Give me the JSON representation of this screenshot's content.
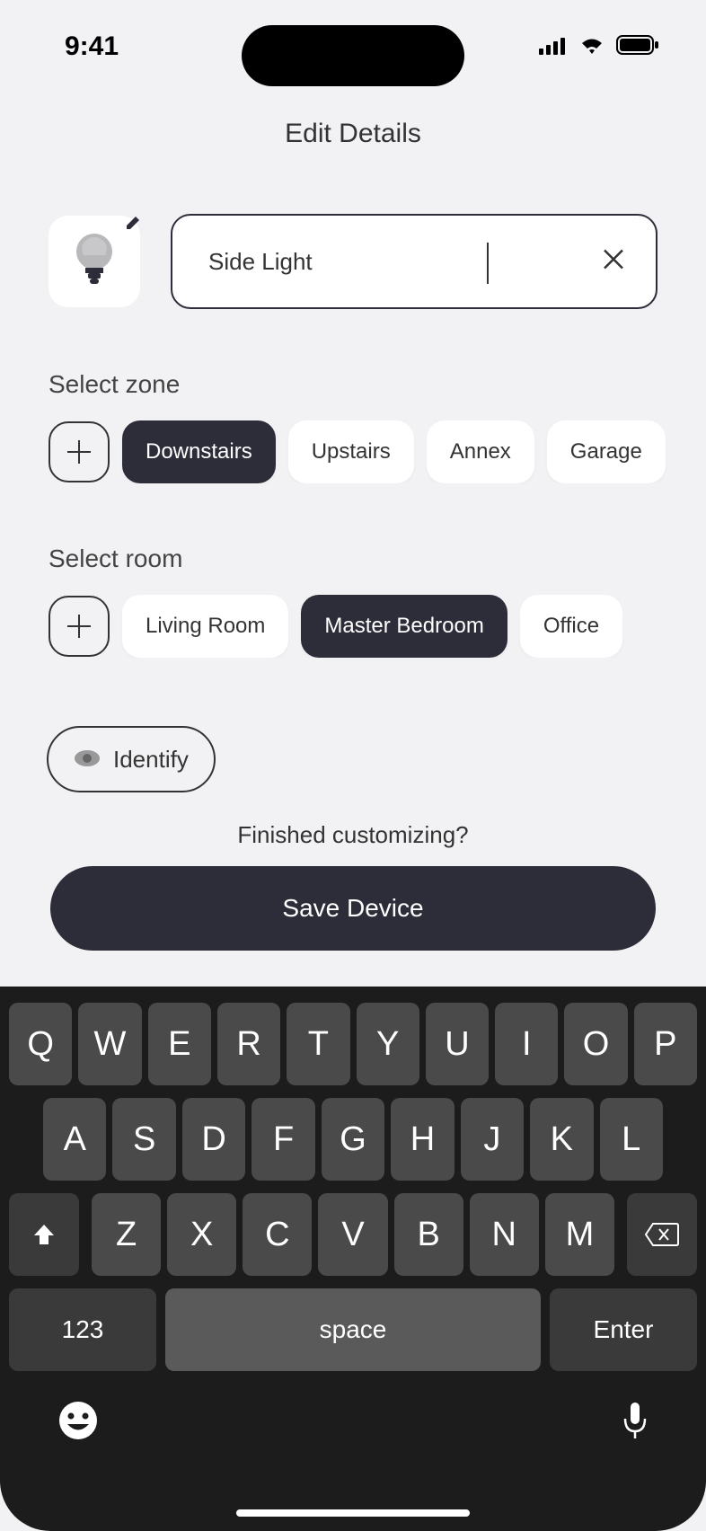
{
  "status": {
    "time": "9:41"
  },
  "header": {
    "title": "Edit Details"
  },
  "device": {
    "name_value": "Side Light"
  },
  "zone": {
    "label": "Select zone",
    "items": [
      "Downstairs",
      "Upstairs",
      "Annex",
      "Garage"
    ],
    "selected": "Downstairs"
  },
  "room": {
    "label": "Select room",
    "items": [
      "Living Room",
      "Master Bedroom",
      "Office"
    ],
    "selected": "Master Bedroom"
  },
  "identify": {
    "label": "Identify"
  },
  "finished": {
    "text": "Finished customizing?"
  },
  "save": {
    "label": "Save Device"
  },
  "keyboard": {
    "row1": [
      "Q",
      "W",
      "E",
      "R",
      "T",
      "Y",
      "U",
      "I",
      "O",
      "P"
    ],
    "row2": [
      "A",
      "S",
      "D",
      "F",
      "G",
      "H",
      "J",
      "K",
      "L"
    ],
    "row3": [
      "Z",
      "X",
      "C",
      "V",
      "B",
      "N",
      "M"
    ],
    "numKey": "123",
    "space": "space",
    "enter": "Enter"
  }
}
